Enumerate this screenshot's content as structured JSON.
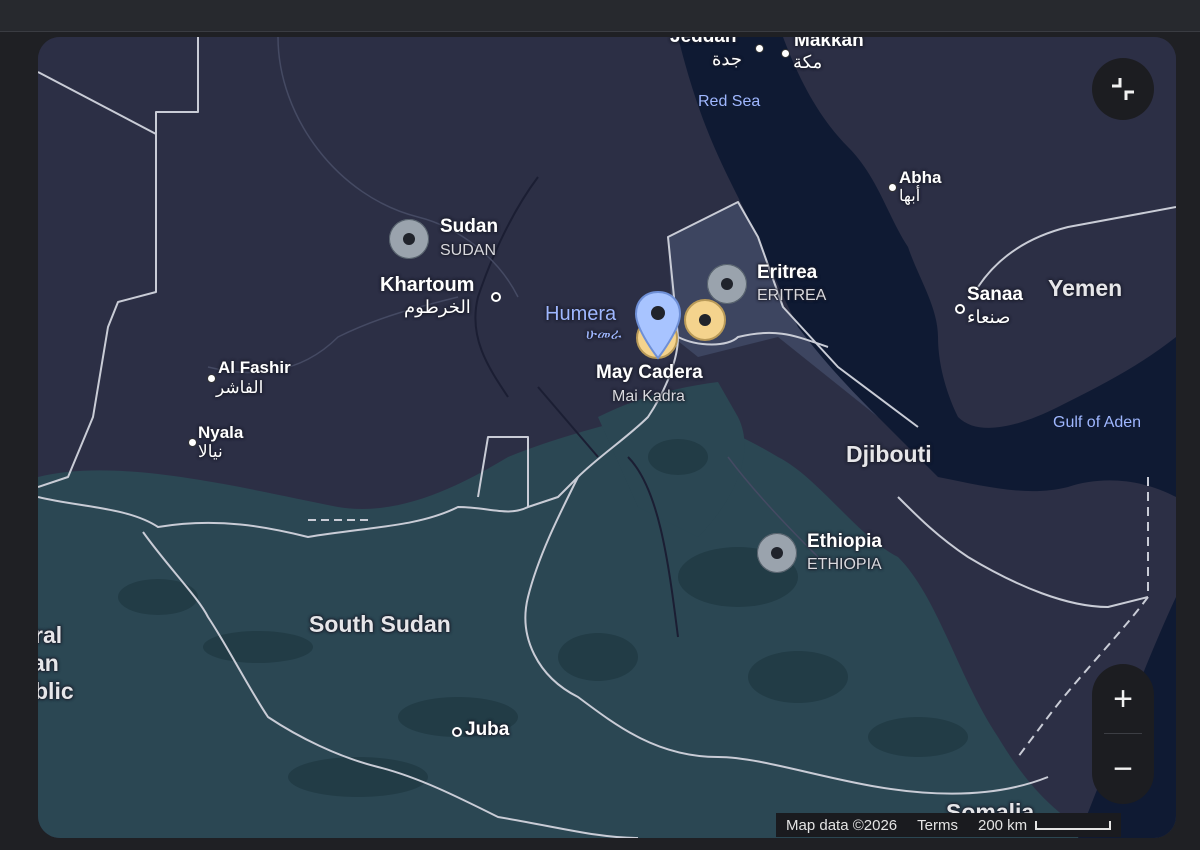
{
  "map": {
    "countries": [
      {
        "name": "Sudan",
        "native": "SUDAN"
      },
      {
        "name": "Eritrea",
        "native": "ERITREA"
      },
      {
        "name": "Ethiopia",
        "native": "ETHIOPIA"
      },
      {
        "name": "Yemen"
      },
      {
        "name": "Djibouti"
      },
      {
        "name": "South Sudan"
      },
      {
        "name": "Somalia"
      },
      {
        "name_partial": [
          "ral",
          "an",
          "blic"
        ]
      }
    ],
    "cities": {
      "jeddah": {
        "name": "Jeddah",
        "arabic": "جدة"
      },
      "makkah": {
        "name": "Makkah",
        "arabic": "مكة"
      },
      "abha": {
        "name": "Abha",
        "arabic": "أبها"
      },
      "sanaa": {
        "name": "Sanaa",
        "arabic": "صنعاء"
      },
      "khartoum": {
        "name": "Khartoum",
        "arabic": "الخرطوم"
      },
      "al_fashir": {
        "name": "Al Fashir",
        "arabic": "الفاشر"
      },
      "nyala": {
        "name": "Nyala",
        "arabic": "نيالا"
      },
      "juba": {
        "name": "Juba"
      },
      "humera": {
        "name": "Humera",
        "native": "ሁመራ"
      },
      "may_cadera": {
        "name": "May Cadera",
        "alt": "Mai Kadra"
      }
    },
    "water": {
      "red_sea": "Red Sea",
      "gulf_of_aden": "Gulf of Aden"
    },
    "colors": {
      "land": "#2c2f45",
      "savanna": "#2b4753",
      "sea": "#0f1a33",
      "border": "#c9ccd6",
      "highlight": "#3d4560",
      "pin_blue": "#a8c4ff",
      "pin_yellow": "#f4d38d"
    }
  },
  "controls": {
    "exit_fullscreen_icon": "exit-fullscreen-icon",
    "zoom_in_label": "+",
    "zoom_out_label": "−"
  },
  "attribution": {
    "map_data": "Map data ©2026",
    "terms": "Terms",
    "scale": "200 km"
  }
}
